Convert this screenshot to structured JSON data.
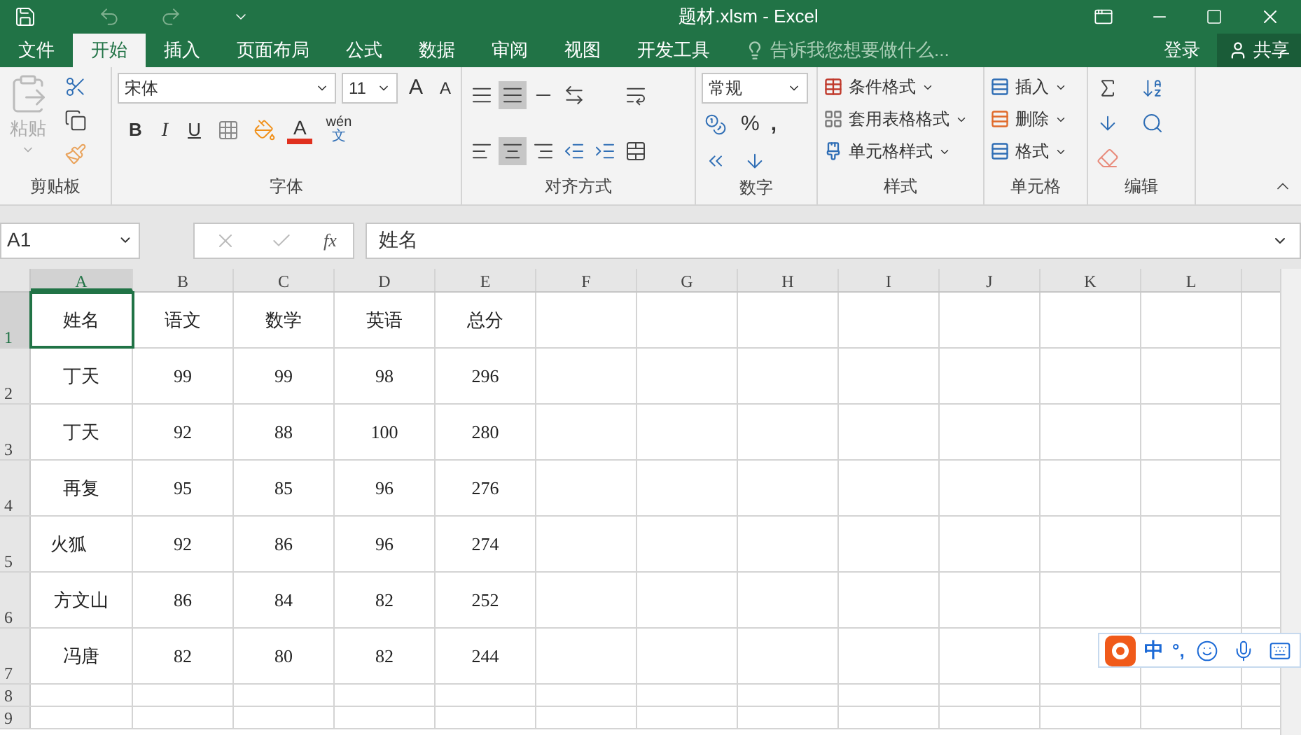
{
  "window": {
    "title": "题材.xlsm - Excel"
  },
  "tabs": [
    {
      "label": "文件",
      "selected": false
    },
    {
      "label": "开始",
      "selected": true
    },
    {
      "label": "插入",
      "selected": false
    },
    {
      "label": "页面布局",
      "selected": false
    },
    {
      "label": "公式",
      "selected": false
    },
    {
      "label": "数据",
      "selected": false
    },
    {
      "label": "审阅",
      "selected": false
    },
    {
      "label": "视图",
      "selected": false
    },
    {
      "label": "开发工具",
      "selected": false
    }
  ],
  "tell_me": {
    "placeholder": "告诉我您想要做什么..."
  },
  "login": "登录",
  "share": "共享",
  "ribbon": {
    "clipboard": {
      "label": "剪贴板",
      "paste": "粘贴"
    },
    "font": {
      "label": "字体",
      "font_name": "宋体",
      "font_size": "11",
      "grow": "A",
      "shrink": "A",
      "bold": "B",
      "italic": "I",
      "underline": "U",
      "font_color": "A",
      "phonetic_top": "wén",
      "phonetic_bottom": "文"
    },
    "alignment": {
      "label": "对齐方式"
    },
    "number": {
      "label": "数字",
      "format": "常规",
      "percent": "%",
      "comma": ","
    },
    "styles": {
      "label": "样式",
      "items": [
        "条件格式",
        "套用表格格式",
        "单元格样式"
      ]
    },
    "cells": {
      "label": "单元格",
      "items": [
        "插入",
        "删除",
        "格式"
      ]
    },
    "editing": {
      "label": "编辑"
    }
  },
  "formula_bar": {
    "name_box": "A1",
    "fx": "fx",
    "formula": "姓名"
  },
  "sheet": {
    "columns": [
      {
        "label": "A",
        "selected": true
      },
      {
        "label": "B",
        "selected": false
      },
      {
        "label": "C",
        "selected": false
      },
      {
        "label": "D",
        "selected": false
      },
      {
        "label": "E",
        "selected": false
      },
      {
        "label": "F",
        "selected": false
      },
      {
        "label": "G",
        "selected": false
      },
      {
        "label": "H",
        "selected": false
      },
      {
        "label": "I",
        "selected": false
      },
      {
        "label": "J",
        "selected": false
      },
      {
        "label": "K",
        "selected": false
      },
      {
        "label": "L",
        "selected": false
      }
    ],
    "rows": [
      {
        "header": "1",
        "kind": "tall",
        "selected": true,
        "left_aligned": false,
        "cells": [
          "姓名",
          "语文",
          "数学",
          "英语",
          "总分"
        ]
      },
      {
        "header": "2",
        "kind": "tall",
        "selected": false,
        "left_aligned": false,
        "cells": [
          "丁天",
          "99",
          "99",
          "98",
          "296"
        ]
      },
      {
        "header": "3",
        "kind": "tall",
        "selected": false,
        "left_aligned": false,
        "cells": [
          "丁天",
          "92",
          "88",
          "100",
          "280"
        ]
      },
      {
        "header": "4",
        "kind": "tall",
        "selected": false,
        "left_aligned": false,
        "cells": [
          "再复",
          "95",
          "85",
          "96",
          "276"
        ]
      },
      {
        "header": "5",
        "kind": "tall",
        "selected": false,
        "left_aligned": true,
        "cells": [
          "火狐",
          "92",
          "86",
          "96",
          "274"
        ]
      },
      {
        "header": "6",
        "kind": "tall",
        "selected": false,
        "left_aligned": false,
        "cells": [
          "方文山",
          "86",
          "84",
          "82",
          "252"
        ]
      },
      {
        "header": "7",
        "kind": "tall",
        "selected": false,
        "left_aligned": false,
        "cells": [
          "冯唐",
          "82",
          "80",
          "82",
          "244"
        ]
      },
      {
        "header": "8",
        "kind": "short",
        "selected": false,
        "cells": []
      },
      {
        "header": "9",
        "kind": "short",
        "selected": false,
        "cells": []
      }
    ]
  },
  "ime_bar": {
    "mode": "中",
    "punct": "°,"
  }
}
